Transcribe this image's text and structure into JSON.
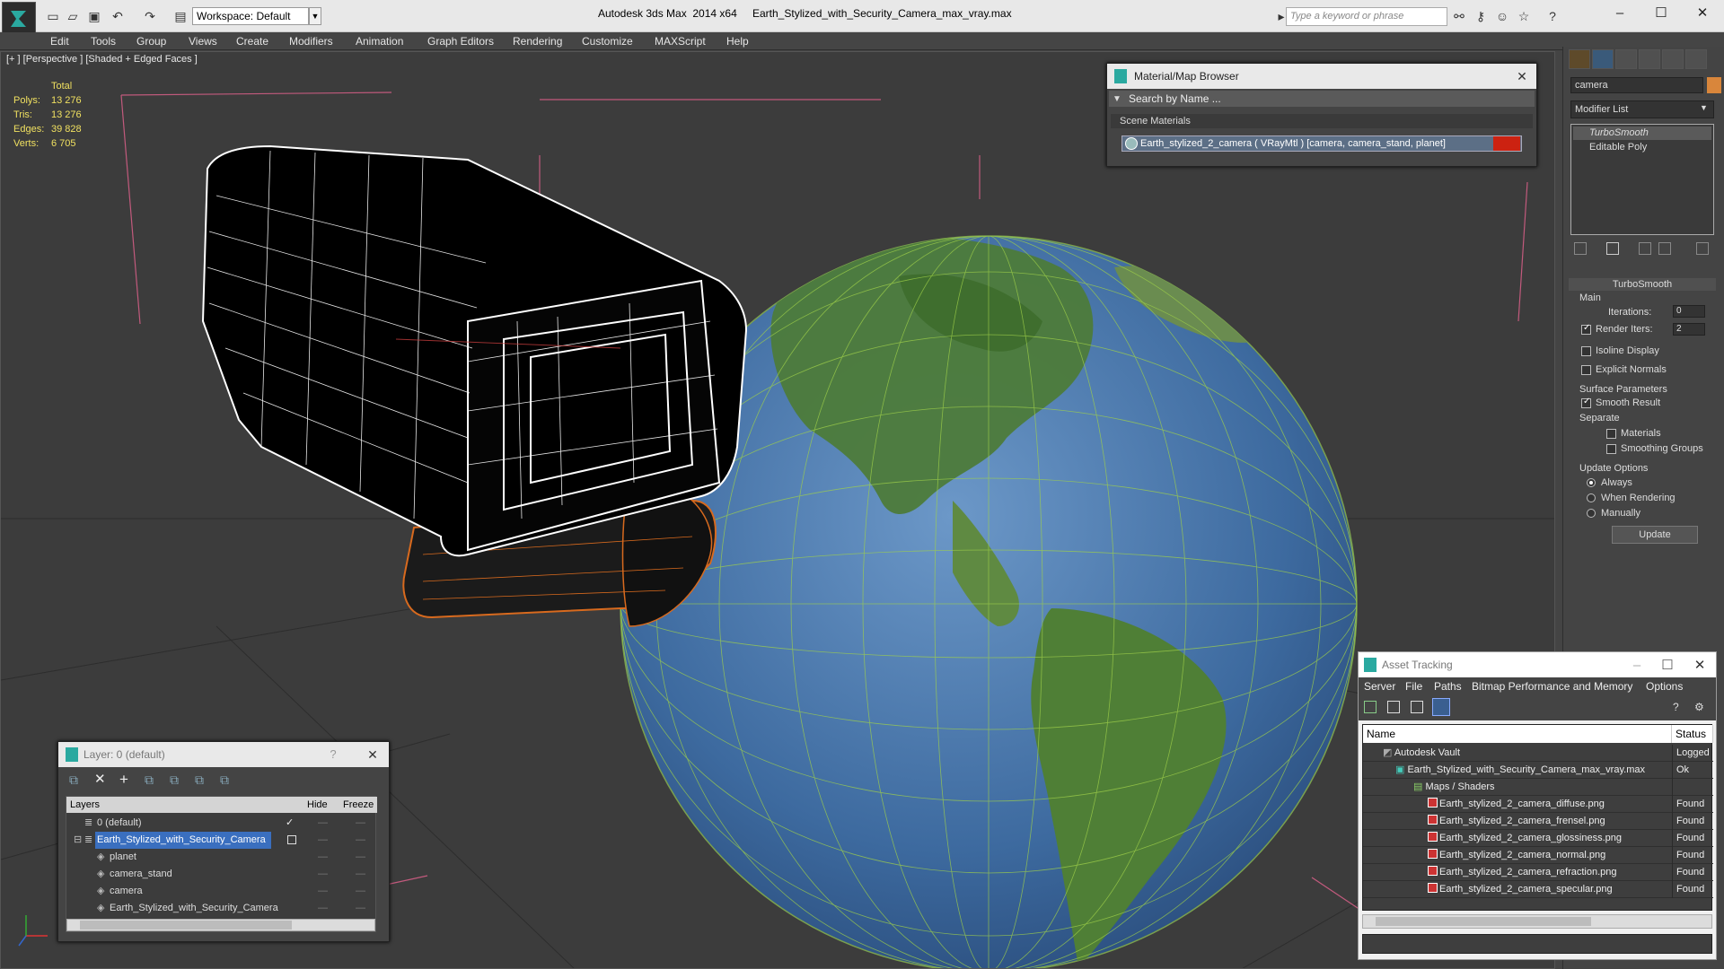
{
  "titlebar": {
    "app": "Autodesk 3ds Max  2014 x64",
    "file": "Earth_Stylized_with_Security_Camera_max_vray.max",
    "workspace": "Workspace: Default",
    "search_placeholder": "Type a keyword or phrase"
  },
  "menu": [
    "Edit",
    "Tools",
    "Group",
    "Views",
    "Create",
    "Modifiers",
    "Animation",
    "Graph Editors",
    "Rendering",
    "Customize",
    "MAXScript",
    "Help"
  ],
  "viewport": {
    "label": "[+ ] [Perspective ] [Shaded + Edged Faces ]",
    "stats": {
      "header": "Total",
      "rows": [
        {
          "label": "Polys:",
          "value": "13 276"
        },
        {
          "label": "Tris:",
          "value": "13 276"
        },
        {
          "label": "Edges:",
          "value": "39 828"
        },
        {
          "label": "Verts:",
          "value": "6 705"
        }
      ]
    }
  },
  "material_browser": {
    "title": "Material/Map Browser",
    "search": "Search by Name ...",
    "section": "Scene Materials",
    "item": "Earth_stylized_2_camera  ( VRayMtl ) [camera, camera_stand, planet]"
  },
  "command_panel": {
    "object_name": "camera",
    "modifier_list": "Modifier List",
    "stack": [
      "TurboSmooth",
      "Editable Poly"
    ],
    "rollout": {
      "title": "TurboSmooth",
      "main": "Main",
      "iterations_label": "Iterations:",
      "iterations": "0",
      "render_iters_label": "Render Iters:",
      "render_iters": "2",
      "isoline": "Isoline Display",
      "explicit": "Explicit Normals",
      "surface": "Surface Parameters",
      "smooth_result": "Smooth Result",
      "separate": "Separate",
      "materials": "Materials",
      "smoothing_groups": "Smoothing Groups",
      "update_options": "Update Options",
      "always": "Always",
      "when_rendering": "When Rendering",
      "manually": "Manually",
      "update": "Update"
    }
  },
  "layer_window": {
    "title": "Layer: 0 (default)",
    "columns": [
      "Layers",
      "Hide",
      "Freeze"
    ],
    "rows": [
      {
        "name": "0 (default)",
        "indent": 1
      },
      {
        "name": "Earth_Stylized_with_Security_Camera",
        "indent": 1
      },
      {
        "name": "planet",
        "indent": 2
      },
      {
        "name": "camera_stand",
        "indent": 2
      },
      {
        "name": "camera",
        "indent": 2
      },
      {
        "name": "Earth_Stylized_with_Security_Camera",
        "indent": 2
      }
    ]
  },
  "asset_tracking": {
    "title": "Asset Tracking",
    "menu": [
      "Server",
      "File",
      "Paths",
      "Bitmap Performance and Memory",
      "Options"
    ],
    "columns": [
      "Name",
      "Status"
    ],
    "rows": [
      {
        "name": "Autodesk Vault",
        "status": "Logged O"
      },
      {
        "name": "Earth_Stylized_with_Security_Camera_max_vray.max",
        "status": "Ok"
      },
      {
        "name": "Maps / Shaders",
        "status": ""
      },
      {
        "name": "Earth_stylized_2_camera_diffuse.png",
        "status": "Found"
      },
      {
        "name": "Earth_stylized_2_camera_frensel.png",
        "status": "Found"
      },
      {
        "name": "Earth_stylized_2_camera_glossiness.png",
        "status": "Found"
      },
      {
        "name": "Earth_stylized_2_camera_normal.png",
        "status": "Found"
      },
      {
        "name": "Earth_stylized_2_camera_refraction.png",
        "status": "Found"
      },
      {
        "name": "Earth_stylized_2_camera_specular.png",
        "status": "Found"
      }
    ]
  }
}
